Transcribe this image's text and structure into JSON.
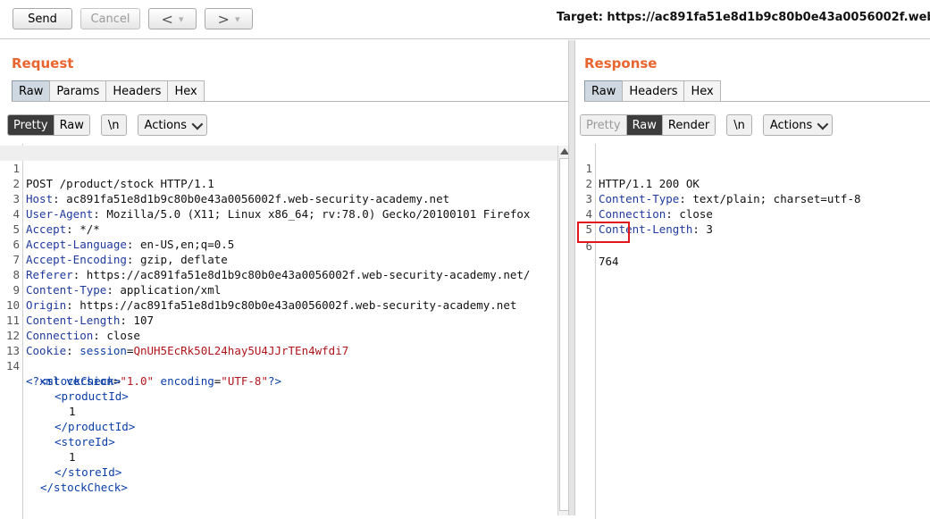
{
  "toolbar": {
    "send_label": "Send",
    "cancel_label": "Cancel",
    "back_glyph": "<",
    "forward_glyph": ">",
    "dropdown_glyph": "▾",
    "target_text": "Target: https://ac891fa51e8d1b9c80b0e43a0056002f.web"
  },
  "request": {
    "title": "Request",
    "tabs": [
      "Raw",
      "Params",
      "Headers",
      "Hex"
    ],
    "view_options": [
      "Pretty",
      "Raw"
    ],
    "newline_label": "\\n",
    "actions_label": "Actions",
    "lines": [
      {
        "n": "1",
        "name": "",
        "value": "POST /product/stock HTTP/1.1"
      },
      {
        "n": "2",
        "name": "Host",
        "value": " ac891fa51e8d1b9c80b0e43a0056002f.web-security-academy.net"
      },
      {
        "n": "3",
        "name": "User-Agent",
        "value": " Mozilla/5.0 (X11; Linux x86_64; rv:78.0) Gecko/20100101 Firefox"
      },
      {
        "n": "4",
        "name": "Accept",
        "value": " */*"
      },
      {
        "n": "5",
        "name": "Accept-Language",
        "value": " en-US,en;q=0.5"
      },
      {
        "n": "6",
        "name": "Accept-Encoding",
        "value": " gzip, deflate"
      },
      {
        "n": "7",
        "name": "Referer",
        "value": " https://ac891fa51e8d1b9c80b0e43a0056002f.web-security-academy.net/"
      },
      {
        "n": "8",
        "name": "Content-Type",
        "value": " application/xml"
      },
      {
        "n": "9",
        "name": "Origin",
        "value": " https://ac891fa51e8d1b9c80b0e43a0056002f.web-security-academy.net"
      },
      {
        "n": "10",
        "name": "Content-Length",
        "value": " 107"
      },
      {
        "n": "11",
        "name": "Connection",
        "value": " close"
      },
      {
        "n": "12",
        "name": "Cookie",
        "value": " ",
        "cookie_name": "session",
        "cookie_value": "QnUH5EcRk50L24hay5U4JJrTEn4wfdi7"
      },
      {
        "n": "13",
        "name": "",
        "value": ""
      }
    ],
    "xml": {
      "line_number": "14",
      "decl_open": "<?xml ",
      "attr1_name": "version",
      "attr1_value": "\"1.0\"",
      "attr2_name": "encoding",
      "attr2_value": "\"UTF-8\"",
      "decl_close": "?>",
      "stockcheck_open": "<stockCheck>",
      "productid_open": "<productId>",
      "productid_value": "1",
      "productid_close": "</productId>",
      "storeid_open": "<storeId>",
      "storeid_value": "1",
      "storeid_close": "</storeId>",
      "stockcheck_close": "</stockCheck>"
    }
  },
  "response": {
    "title": "Response",
    "tabs": [
      "Raw",
      "Headers",
      "Hex"
    ],
    "view_options": [
      "Pretty",
      "Raw",
      "Render"
    ],
    "newline_label": "\\n",
    "actions_label": "Actions",
    "lines": [
      {
        "n": "1",
        "name": "",
        "value": "HTTP/1.1 200 OK"
      },
      {
        "n": "2",
        "name": "Content-Type",
        "value": " text/plain; charset=utf-8"
      },
      {
        "n": "3",
        "name": "Connection",
        "value": " close"
      },
      {
        "n": "4",
        "name": "Content-Length",
        "value": " 3"
      },
      {
        "n": "5",
        "name": "",
        "value": ""
      },
      {
        "n": "6",
        "name": "",
        "value": "764"
      }
    ]
  },
  "colors": {
    "accent": "#e8652f",
    "highlight_box": "#e0161c"
  }
}
